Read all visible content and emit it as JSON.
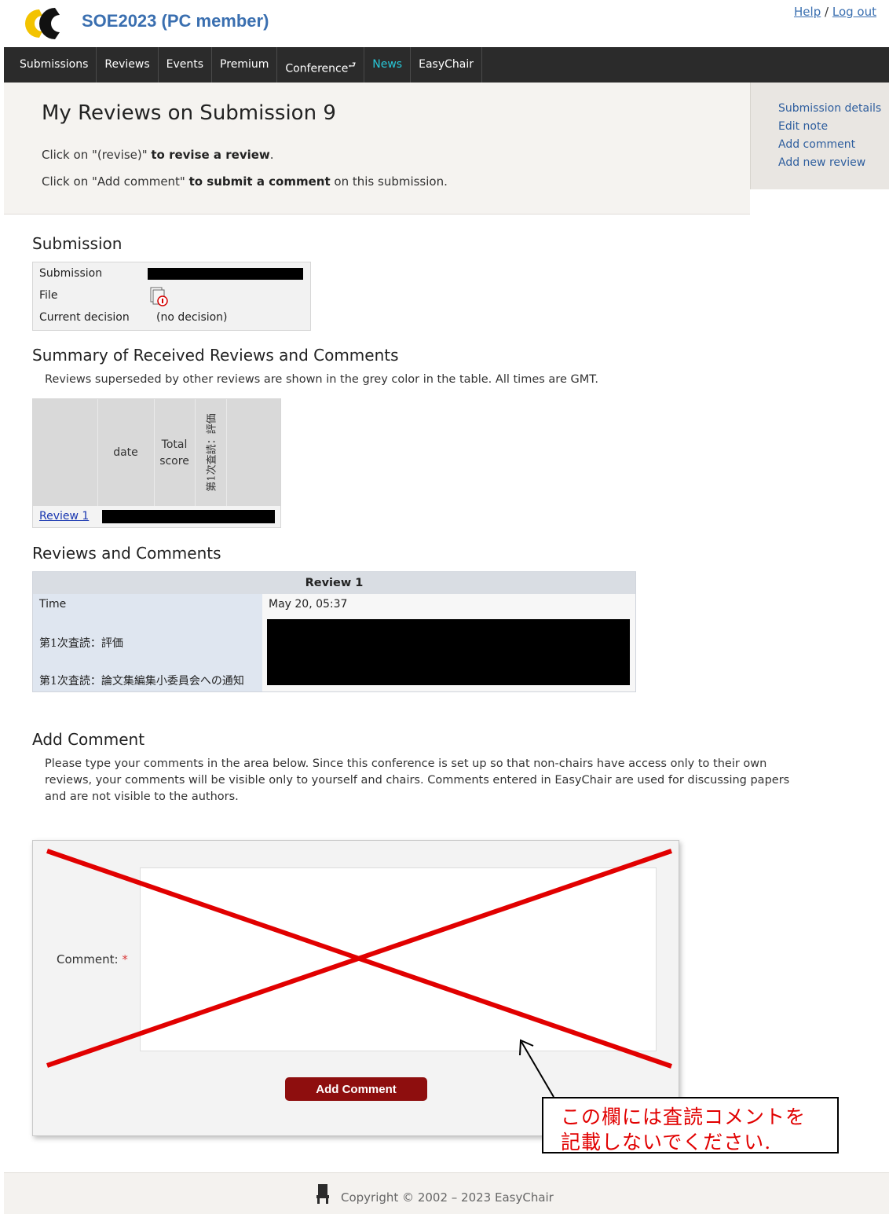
{
  "header": {
    "app_title": "SOE2023 (PC member)",
    "help": "Help",
    "separator": "/",
    "logout": "Log out"
  },
  "nav": {
    "items": [
      "Submissions",
      "Reviews",
      "Events",
      "Premium",
      "Conference",
      "News",
      "EasyChair"
    ],
    "active": "News"
  },
  "page": {
    "title": "My Reviews on Submission 9",
    "help1_pre": "Click on \"(revise)\" ",
    "help1_bold": "to revise a review",
    "help1_post": ".",
    "help2_pre": "Click on \"Add comment\" ",
    "help2_bold": "to submit a comment",
    "help2_post": " on this submission."
  },
  "side_links": [
    "Submission details",
    "Edit note",
    "Add comment",
    "Add new review"
  ],
  "submission": {
    "heading": "Submission",
    "rows": [
      {
        "label": "Submission",
        "value": ""
      },
      {
        "label": "File",
        "value": ""
      },
      {
        "label": "Current decision",
        "value": "(no decision)"
      }
    ]
  },
  "summary": {
    "heading": "Summary of Received Reviews and Comments",
    "note": "Reviews superseded by other reviews are shown in the grey color in the table. All times are GMT.",
    "columns": [
      "date",
      "Total",
      "score",
      "第1次査読：評価"
    ],
    "rows": [
      {
        "label": "Review 1"
      }
    ]
  },
  "reviews": {
    "heading": "Reviews and Comments",
    "title": "Review 1",
    "time_label": "Time",
    "time_value": "May 20, 05:37",
    "field1_label": "第1次査読：評価",
    "field2_label": "第1次査読：論文集編集小委員会への通知"
  },
  "add_comment": {
    "heading": "Add Comment",
    "note_line1": "Please type your comments in the area below. Since this conference is set up so that non-chairs have access only to their own",
    "note_line2": "reviews, your comments will be visible only to yourself and chairs. Comments entered in EasyChair are used for discussing papers",
    "note_line3": "and are not visible to the authors.",
    "label": "Comment:",
    "required_mark": "*",
    "comment_value": "",
    "button": "Add Comment"
  },
  "callout": {
    "line1": "この欄には査読コメントを",
    "line2": "記載しないでください."
  },
  "footer": {
    "copyright": "Copyright © 2002 – 2023 EasyChair"
  },
  "colors": {
    "nav_bg": "#2b2b2b",
    "active_nav": "#28c8d8",
    "button_bg": "#8e0e0e",
    "annotation_red": "#e10000",
    "title_blue": "#3a6fb0"
  }
}
